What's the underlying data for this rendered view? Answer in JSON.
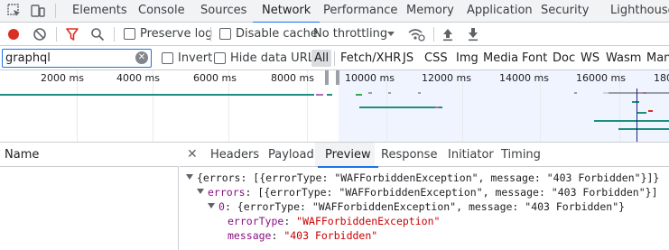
{
  "devtools_tabs": [
    {
      "label": "Elements"
    },
    {
      "label": "Console"
    },
    {
      "label": "Sources"
    },
    {
      "label": "Network"
    },
    {
      "label": "Performance"
    },
    {
      "label": "Memory"
    },
    {
      "label": "Application"
    },
    {
      "label": "Security"
    },
    {
      "label": "Lighthouse"
    }
  ],
  "active_tab": "Network",
  "toolbar": {
    "preserve_log": "Preserve log",
    "disable_cache": "Disable cache",
    "throttling": "No throttling",
    "preserve_log_checked": false,
    "disable_cache_checked": false
  },
  "filter": {
    "value": "graphql",
    "invert": "Invert",
    "hide_data_urls": "Hide data URLs",
    "types": [
      "All",
      "Fetch/XHR",
      "JS",
      "CSS",
      "Img",
      "Media",
      "Font",
      "Doc",
      "WS",
      "Wasm",
      "Mani"
    ],
    "selected_type": "All"
  },
  "overview": {
    "tick_labels": [
      "2000 ms",
      "4000 ms",
      "6000 ms",
      "8000 ms",
      "10000 ms",
      "12000 ms",
      "14000 ms",
      "16000 ms",
      "1800"
    ]
  },
  "request_list": {
    "name_header": "Name"
  },
  "details": {
    "close": "✕",
    "tabs": [
      "Headers",
      "Payload",
      "Preview",
      "Response",
      "Initiator",
      "Timing"
    ],
    "active_tab": "Preview",
    "preview": {
      "root": "{errors: [{errorType: \"WAFForbiddenException\", message: \"403 Forbidden\"}]}",
      "errors_key": "errors",
      "errors_summary": ": [{errorType: \"WAFForbiddenException\", message: \"403 Forbidden\"}]",
      "item_key": "0",
      "item_summary": ": {errorType: \"WAFForbiddenException\", message: \"403 Forbidden\"}",
      "error_type_key": "errorType",
      "error_type_value": "\"WAFForbiddenException\"",
      "message_key": "message",
      "message_value": "\"403 Forbidden\""
    }
  },
  "colors": {
    "accent": "#1a73e8",
    "record_red": "#d93025",
    "filter_red": "#d93025",
    "timeline_green": "#1e8e7e",
    "json_key": "#881280",
    "json_string": "#c80000"
  }
}
